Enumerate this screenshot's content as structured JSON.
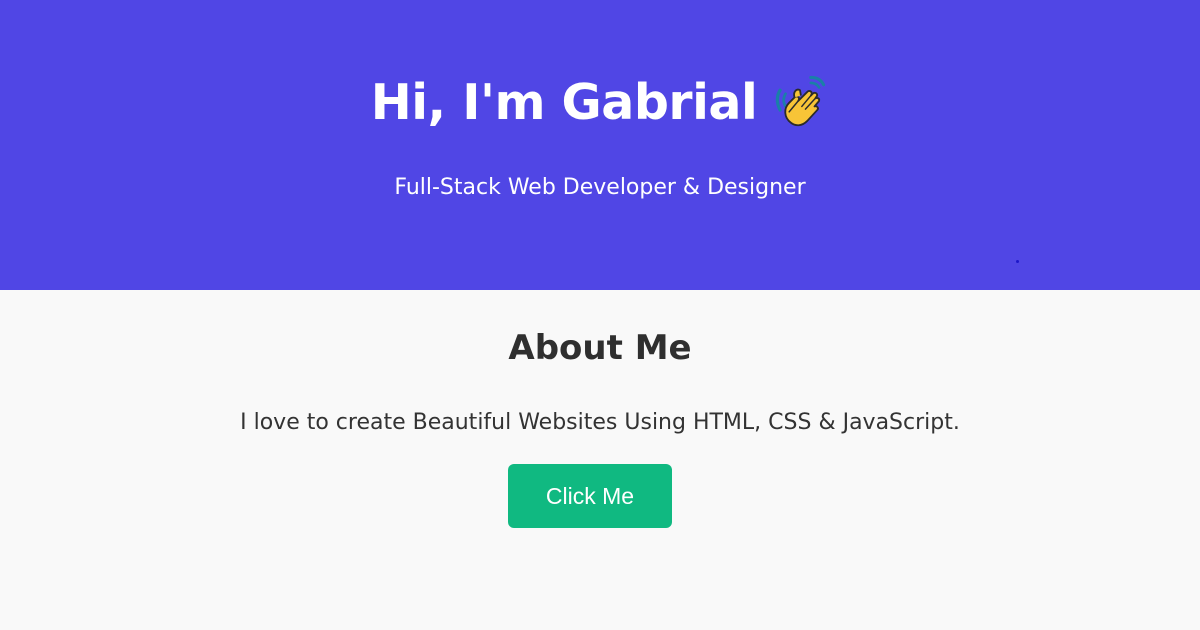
{
  "hero": {
    "title": "Hi, I'm Gabrial",
    "title_icon": "waving-hand-icon",
    "subtitle": "Full-Stack Web Developer & Designer",
    "background_color": "#5046e5",
    "text_color": "#ffffff"
  },
  "about": {
    "heading": "About Me",
    "description": "I love to create Beautiful Websites Using HTML, CSS & JavaScript.",
    "background_color": "#f9f9f9"
  },
  "cta": {
    "label": "Click Me",
    "background_color": "#10b981",
    "text_color": "#ffffff"
  }
}
